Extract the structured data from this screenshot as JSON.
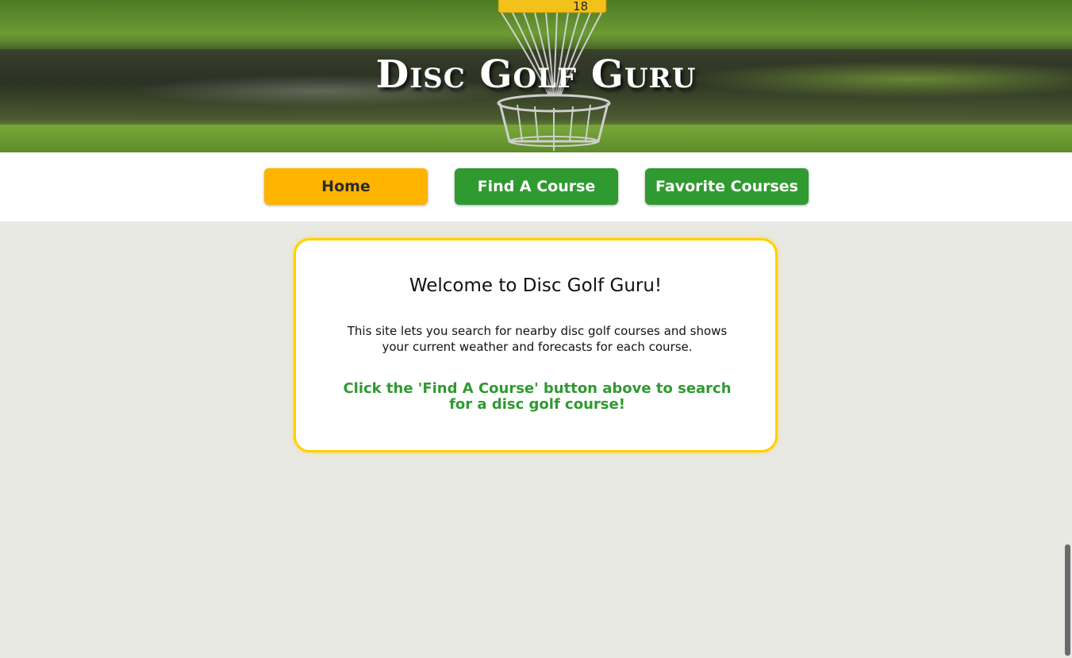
{
  "site": {
    "title": "Disc Golf Guru"
  },
  "nav": {
    "items": [
      {
        "label": "Home",
        "active": true
      },
      {
        "label": "Find A Course",
        "active": false
      },
      {
        "label": "Favorite Courses",
        "active": false
      }
    ]
  },
  "welcome": {
    "heading": "Welcome to Disc Golf Guru!",
    "description": "This site lets you search for nearby disc golf courses and shows your current weather and forecasts for each course.",
    "cta": "Click the 'Find A Course' button above to search for a disc golf course!"
  },
  "hero": {
    "basket_number": "18"
  },
  "colors": {
    "accent_yellow": "#ffb400",
    "accent_green": "#2f9a30",
    "card_border": "#ffcf00",
    "page_background": "#e9e9e3"
  }
}
